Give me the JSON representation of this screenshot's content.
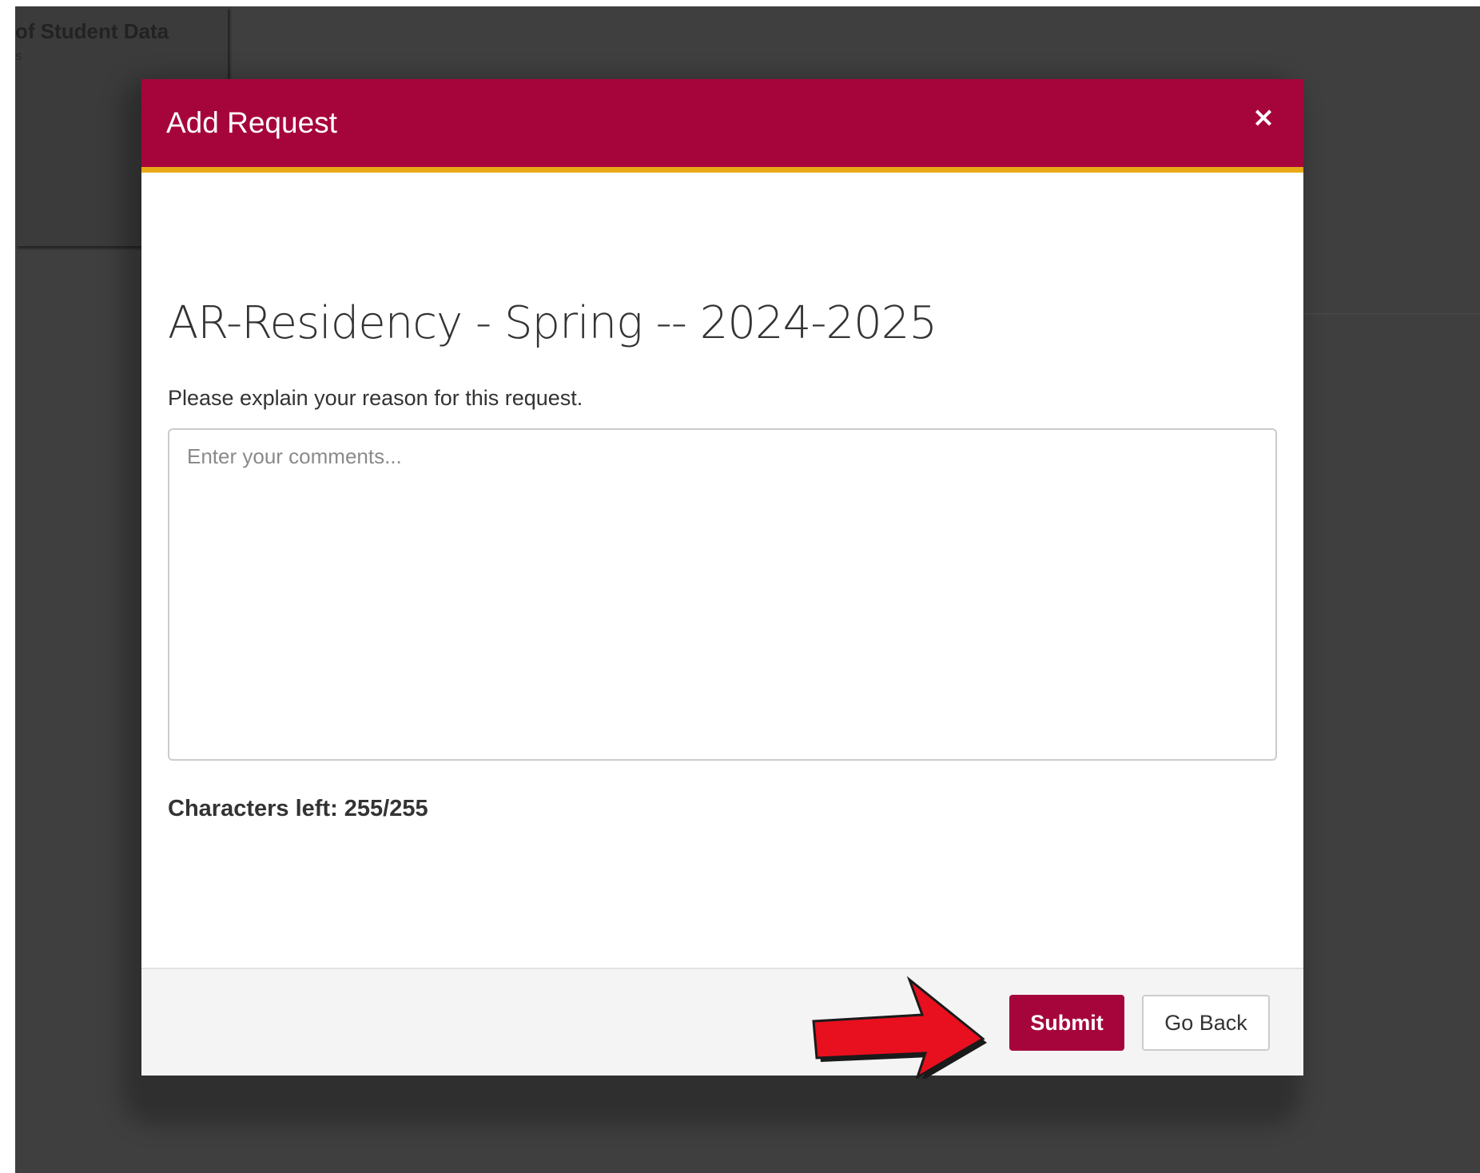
{
  "background": {
    "card_title": "of Student Data",
    "card_subtitle": "s"
  },
  "modal": {
    "title": "Add Request",
    "close_label": "×",
    "request_name": "AR-Residency - Spring -- 2024-2025",
    "reason_prompt": "Please explain your reason for this request.",
    "comments": {
      "value": "",
      "placeholder": "Enter your comments..."
    },
    "characters_left": "Characters left: 255/255",
    "submit_label": "Submit",
    "go_back_label": "Go Back"
  },
  "colors": {
    "header": "#a6053c",
    "header_accent": "#e8a917",
    "submit": "#a6053c",
    "annotation_arrow": "#e8101f"
  },
  "annotation": {
    "icon": "red-arrow-icon"
  }
}
